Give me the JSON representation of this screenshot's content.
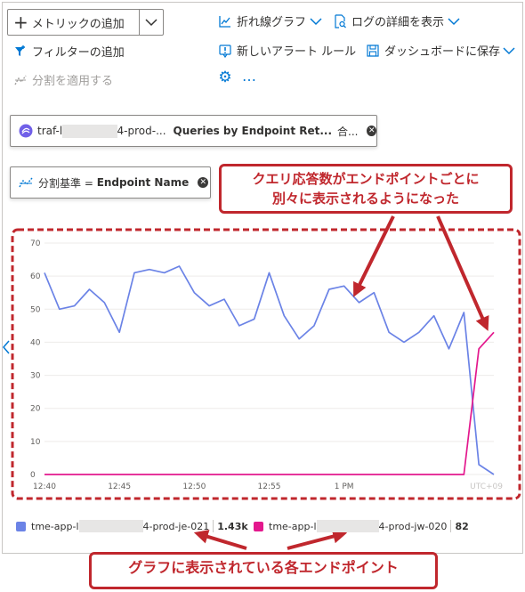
{
  "toolbar": {
    "add_metric": "メトリックの追加",
    "add_filter": "フィルターの追加",
    "apply_split": "分割を適用する",
    "line_chart": "折れ線グラフ",
    "view_logs": "ログの詳細を表示",
    "new_alert": "新しいアラート ルール",
    "save_dashboard": "ダッシュボードに保存",
    "more": "…"
  },
  "metric_pill": {
    "resource_prefix": "traf-l",
    "resource_suffix": "4-prod-...",
    "metric": "Queries by Endpoint Ret...",
    "aggregation": "合..."
  },
  "split_pill": {
    "label": "分割基準 = ",
    "value": "Endpoint Name"
  },
  "annotations": {
    "top_line1": "クエリ応答数がエンドポイントごとに",
    "top_line2": "別々に表示されるようになった",
    "bottom": "グラフに表示されている各エンドポイント"
  },
  "colors": {
    "series_a": "#6b83e6",
    "series_b": "#e3188d",
    "annotation": "#c0272d",
    "accent": "#0078d4"
  },
  "chart_data": {
    "type": "line",
    "title": "",
    "xlabel": "",
    "ylabel": "",
    "ylim": [
      0,
      70
    ],
    "y_ticks": [
      0,
      10,
      20,
      30,
      40,
      50,
      60,
      70
    ],
    "x_ticks": [
      "12:40",
      "12:45",
      "12:50",
      "12:55",
      "1 PM",
      "UTC+09"
    ],
    "grid": true,
    "x_minutes_from_1240": [
      0,
      1,
      2,
      3,
      4,
      5,
      6,
      7,
      8,
      9,
      10,
      11,
      12,
      13,
      14,
      15,
      16,
      17,
      18,
      19,
      20,
      21,
      22,
      23,
      24,
      25,
      26,
      27,
      28,
      29,
      30
    ],
    "series": [
      {
        "name": "tme-app-l",
        "name_suffix": "4-prod-je-021",
        "total": "1.43k",
        "values": [
          61,
          50,
          51,
          56,
          52,
          43,
          61,
          62,
          61,
          63,
          55,
          51,
          53,
          45,
          47,
          61,
          48,
          41,
          45,
          56,
          57,
          52,
          55,
          43,
          40,
          43,
          48,
          38,
          49,
          3,
          0
        ]
      },
      {
        "name": "tme-app-l",
        "name_suffix": "4-prod-jw-020",
        "total": "82",
        "values": [
          0,
          0,
          0,
          0,
          0,
          0,
          0,
          0,
          0,
          0,
          0,
          0,
          0,
          0,
          0,
          0,
          0,
          0,
          0,
          0,
          0,
          0,
          0,
          0,
          0,
          0,
          0,
          0,
          0,
          38,
          43
        ]
      }
    ]
  }
}
